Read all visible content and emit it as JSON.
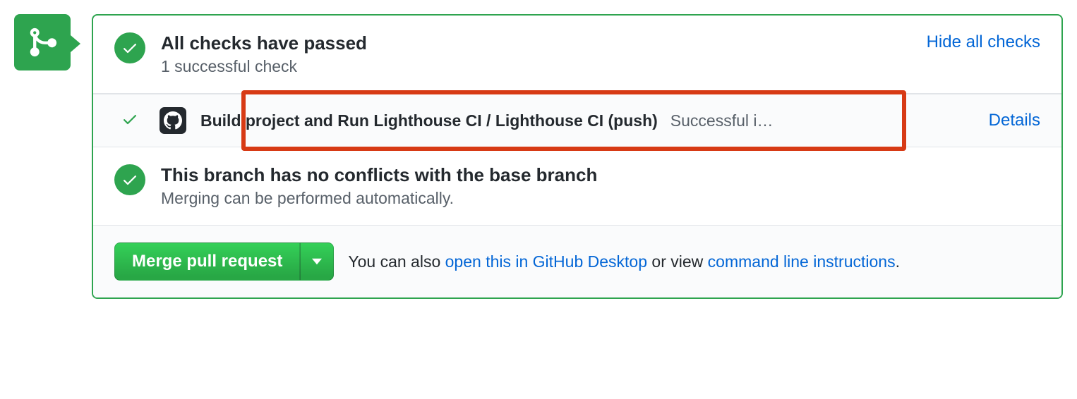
{
  "checks": {
    "title": "All checks have passed",
    "subtitle": "1 successful check",
    "toggle_label": "Hide all checks",
    "items": [
      {
        "name": "Build project and Run Lighthouse CI / Lighthouse CI (push)",
        "status": "Successful i…",
        "details_label": "Details"
      }
    ]
  },
  "conflicts": {
    "title": "This branch has no conflicts with the base branch",
    "subtitle": "Merging can be performed automatically."
  },
  "merge": {
    "button_label": "Merge pull request",
    "help_prefix": "You can also ",
    "desktop_link": "open this in GitHub Desktop",
    "help_middle": " or view ",
    "cli_link": "command line instructions",
    "help_suffix": "."
  }
}
